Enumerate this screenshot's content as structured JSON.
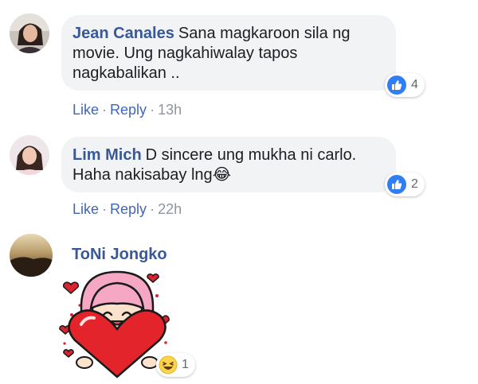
{
  "comments": [
    {
      "author": "Jean Canales",
      "text": "Sana magkaroon sila ng movie. Ung nagkahiwalay tapos nagkabalikan ..",
      "actions": {
        "like": "Like",
        "reply": "Reply",
        "time": "13h"
      },
      "reaction": {
        "icon": "like-icon",
        "count": "4"
      }
    },
    {
      "author": "Lim Mich",
      "text": "D sincere ung mukha ni carlo. Haha nakisabay lng",
      "emoji": "😂",
      "actions": {
        "like": "Like",
        "reply": "Reply",
        "time": "22h"
      },
      "reaction": {
        "icon": "like-icon",
        "count": "2"
      }
    },
    {
      "author": "ToNi Jongko",
      "sticker": "heart-girl-sticker",
      "reaction": {
        "icon": "haha-icon",
        "count": "1"
      }
    }
  ],
  "colors": {
    "author": "#385898",
    "link": "#4267b2",
    "bubble": "#f2f3f5",
    "like_blue": "#2f7ef5",
    "meta_gray": "#90949c"
  }
}
